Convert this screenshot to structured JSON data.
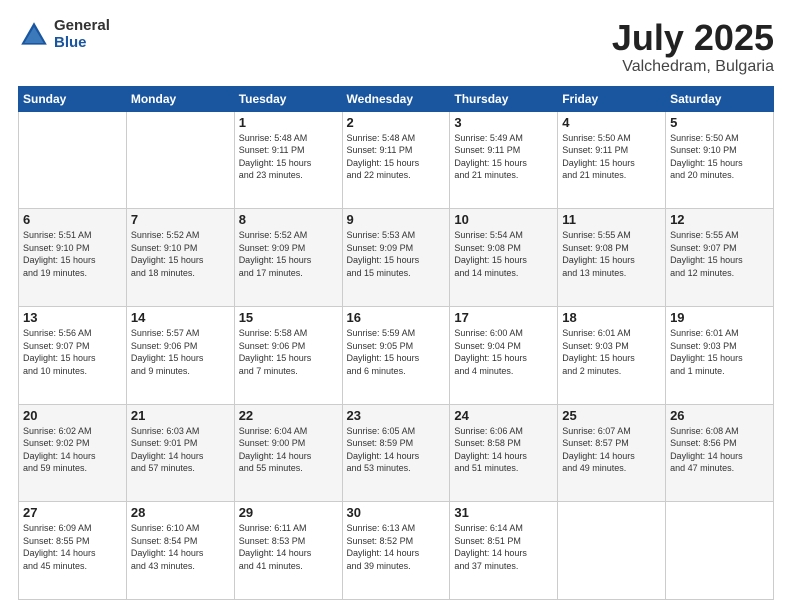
{
  "logo": {
    "general": "General",
    "blue": "Blue"
  },
  "title": {
    "month": "July 2025",
    "location": "Valchedram, Bulgaria"
  },
  "weekdays": [
    "Sunday",
    "Monday",
    "Tuesday",
    "Wednesday",
    "Thursday",
    "Friday",
    "Saturday"
  ],
  "weeks": [
    [
      {
        "day": "",
        "info": ""
      },
      {
        "day": "",
        "info": ""
      },
      {
        "day": "1",
        "info": "Sunrise: 5:48 AM\nSunset: 9:11 PM\nDaylight: 15 hours\nand 23 minutes."
      },
      {
        "day": "2",
        "info": "Sunrise: 5:48 AM\nSunset: 9:11 PM\nDaylight: 15 hours\nand 22 minutes."
      },
      {
        "day": "3",
        "info": "Sunrise: 5:49 AM\nSunset: 9:11 PM\nDaylight: 15 hours\nand 21 minutes."
      },
      {
        "day": "4",
        "info": "Sunrise: 5:50 AM\nSunset: 9:11 PM\nDaylight: 15 hours\nand 21 minutes."
      },
      {
        "day": "5",
        "info": "Sunrise: 5:50 AM\nSunset: 9:10 PM\nDaylight: 15 hours\nand 20 minutes."
      }
    ],
    [
      {
        "day": "6",
        "info": "Sunrise: 5:51 AM\nSunset: 9:10 PM\nDaylight: 15 hours\nand 19 minutes."
      },
      {
        "day": "7",
        "info": "Sunrise: 5:52 AM\nSunset: 9:10 PM\nDaylight: 15 hours\nand 18 minutes."
      },
      {
        "day": "8",
        "info": "Sunrise: 5:52 AM\nSunset: 9:09 PM\nDaylight: 15 hours\nand 17 minutes."
      },
      {
        "day": "9",
        "info": "Sunrise: 5:53 AM\nSunset: 9:09 PM\nDaylight: 15 hours\nand 15 minutes."
      },
      {
        "day": "10",
        "info": "Sunrise: 5:54 AM\nSunset: 9:08 PM\nDaylight: 15 hours\nand 14 minutes."
      },
      {
        "day": "11",
        "info": "Sunrise: 5:55 AM\nSunset: 9:08 PM\nDaylight: 15 hours\nand 13 minutes."
      },
      {
        "day": "12",
        "info": "Sunrise: 5:55 AM\nSunset: 9:07 PM\nDaylight: 15 hours\nand 12 minutes."
      }
    ],
    [
      {
        "day": "13",
        "info": "Sunrise: 5:56 AM\nSunset: 9:07 PM\nDaylight: 15 hours\nand 10 minutes."
      },
      {
        "day": "14",
        "info": "Sunrise: 5:57 AM\nSunset: 9:06 PM\nDaylight: 15 hours\nand 9 minutes."
      },
      {
        "day": "15",
        "info": "Sunrise: 5:58 AM\nSunset: 9:06 PM\nDaylight: 15 hours\nand 7 minutes."
      },
      {
        "day": "16",
        "info": "Sunrise: 5:59 AM\nSunset: 9:05 PM\nDaylight: 15 hours\nand 6 minutes."
      },
      {
        "day": "17",
        "info": "Sunrise: 6:00 AM\nSunset: 9:04 PM\nDaylight: 15 hours\nand 4 minutes."
      },
      {
        "day": "18",
        "info": "Sunrise: 6:01 AM\nSunset: 9:03 PM\nDaylight: 15 hours\nand 2 minutes."
      },
      {
        "day": "19",
        "info": "Sunrise: 6:01 AM\nSunset: 9:03 PM\nDaylight: 15 hours\nand 1 minute."
      }
    ],
    [
      {
        "day": "20",
        "info": "Sunrise: 6:02 AM\nSunset: 9:02 PM\nDaylight: 14 hours\nand 59 minutes."
      },
      {
        "day": "21",
        "info": "Sunrise: 6:03 AM\nSunset: 9:01 PM\nDaylight: 14 hours\nand 57 minutes."
      },
      {
        "day": "22",
        "info": "Sunrise: 6:04 AM\nSunset: 9:00 PM\nDaylight: 14 hours\nand 55 minutes."
      },
      {
        "day": "23",
        "info": "Sunrise: 6:05 AM\nSunset: 8:59 PM\nDaylight: 14 hours\nand 53 minutes."
      },
      {
        "day": "24",
        "info": "Sunrise: 6:06 AM\nSunset: 8:58 PM\nDaylight: 14 hours\nand 51 minutes."
      },
      {
        "day": "25",
        "info": "Sunrise: 6:07 AM\nSunset: 8:57 PM\nDaylight: 14 hours\nand 49 minutes."
      },
      {
        "day": "26",
        "info": "Sunrise: 6:08 AM\nSunset: 8:56 PM\nDaylight: 14 hours\nand 47 minutes."
      }
    ],
    [
      {
        "day": "27",
        "info": "Sunrise: 6:09 AM\nSunset: 8:55 PM\nDaylight: 14 hours\nand 45 minutes."
      },
      {
        "day": "28",
        "info": "Sunrise: 6:10 AM\nSunset: 8:54 PM\nDaylight: 14 hours\nand 43 minutes."
      },
      {
        "day": "29",
        "info": "Sunrise: 6:11 AM\nSunset: 8:53 PM\nDaylight: 14 hours\nand 41 minutes."
      },
      {
        "day": "30",
        "info": "Sunrise: 6:13 AM\nSunset: 8:52 PM\nDaylight: 14 hours\nand 39 minutes."
      },
      {
        "day": "31",
        "info": "Sunrise: 6:14 AM\nSunset: 8:51 PM\nDaylight: 14 hours\nand 37 minutes."
      },
      {
        "day": "",
        "info": ""
      },
      {
        "day": "",
        "info": ""
      }
    ]
  ]
}
